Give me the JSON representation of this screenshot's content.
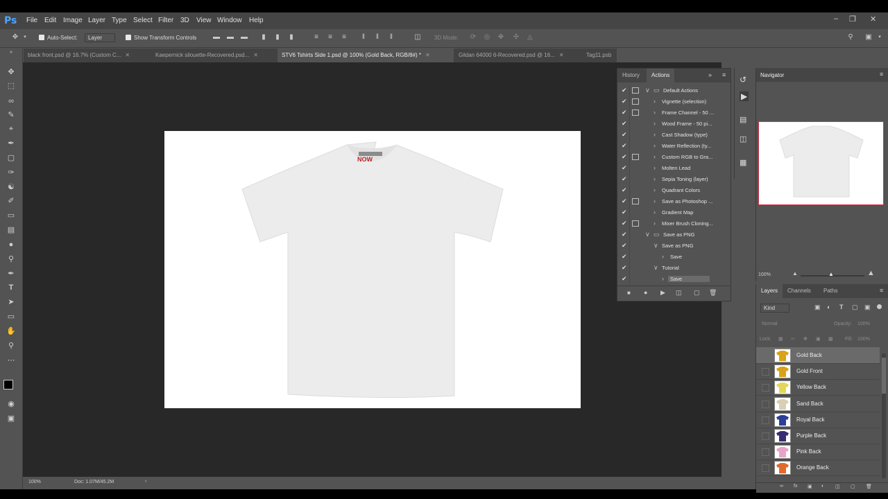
{
  "app": {
    "logo": "Ps",
    "menu": [
      "File",
      "Edit",
      "Image",
      "Layer",
      "Type",
      "Select",
      "Filter",
      "3D",
      "View",
      "Window",
      "Help"
    ]
  },
  "options": {
    "auto_select_label": "Auto-Select:",
    "auto_select_value": "Layer",
    "transform_label": "Show Transform Controls",
    "mode_3d": "3D Mode:"
  },
  "tabs": [
    {
      "label": "black front.psd @ 16.7% (Custom C...",
      "active": false
    },
    {
      "label": "Kaepernick silouette-Recovered.psd...",
      "active": false
    },
    {
      "label": "STV6 Tshirts Side 1.psd @ 100% (Gold Back, RGB/8#) *",
      "active": true
    },
    {
      "label": "Gildan 64000 6-Recovered.psd @ 16...",
      "active": false
    },
    {
      "label": "Tag11.psb",
      "active": false
    }
  ],
  "status": {
    "zoom": "100%",
    "doc": "Doc: 1.07M/45.2M"
  },
  "actions_panel": {
    "tab_history": "History",
    "tab_actions": "Actions",
    "rows": [
      {
        "label": "Default Actions",
        "indent": 0,
        "folder": true,
        "dialog": true,
        "open": true
      },
      {
        "label": "Vignette (selection)",
        "indent": 1,
        "dialog": true
      },
      {
        "label": "Frame Channel - 50 ...",
        "indent": 1,
        "dialog": true
      },
      {
        "label": "Wood Frame - 50 pi...",
        "indent": 1,
        "dialog": false
      },
      {
        "label": "Cast Shadow (type)",
        "indent": 1,
        "dialog": false
      },
      {
        "label": "Water Reflection (ty...",
        "indent": 1,
        "dialog": false
      },
      {
        "label": "Custom RGB to Gra...",
        "indent": 1,
        "dialog": true
      },
      {
        "label": "Molten Lead",
        "indent": 1,
        "dialog": false
      },
      {
        "label": "Sepia Toning (layer)",
        "indent": 1,
        "dialog": false
      },
      {
        "label": "Quadrant Colors",
        "indent": 1,
        "dialog": false
      },
      {
        "label": "Save as Photoshop ...",
        "indent": 1,
        "dialog": true
      },
      {
        "label": "Gradient Map",
        "indent": 1,
        "dialog": false
      },
      {
        "label": "Mixer Brush Cloning...",
        "indent": 1,
        "dialog": true
      },
      {
        "label": "Save as PNG",
        "indent": 0,
        "folder": true,
        "dialog": false,
        "open": true
      },
      {
        "label": "Save as PNG",
        "indent": 1,
        "dialog": false,
        "open": true
      },
      {
        "label": "Save",
        "indent": 2,
        "dialog": false
      },
      {
        "label": "Tutorial",
        "indent": 1,
        "dialog": false,
        "open": true
      },
      {
        "label": "Save",
        "indent": 2,
        "dialog": false,
        "selected": true
      }
    ]
  },
  "navigator": {
    "title": "Navigator",
    "zoom": "100%"
  },
  "layers_panel": {
    "tab_layers": "Layers",
    "tab_channels": "Channels",
    "tab_paths": "Paths",
    "kind": "Kind",
    "blend": "Normal",
    "opacity_label": "Opacity:",
    "opacity": "100%",
    "lock_label": "Lock:",
    "fill_label": "Fill:",
    "fill": "100%",
    "layers": [
      {
        "name": "Gold Back",
        "color": "#d9a21b",
        "selected": true
      },
      {
        "name": "Gold Front",
        "color": "#d9a21b"
      },
      {
        "name": "Yellow Back",
        "color": "#e3d65a"
      },
      {
        "name": "Sand Back",
        "color": "#d8cfb4"
      },
      {
        "name": "Royal Back",
        "color": "#2c3e98"
      },
      {
        "name": "Purple Back",
        "color": "#3a2c72"
      },
      {
        "name": "Pink Back",
        "color": "#e7a4c7"
      },
      {
        "name": "Orange Back",
        "color": "#e06a2c"
      }
    ]
  },
  "colors": {
    "canvas_bg": "#282828",
    "panel": "#535353",
    "accent_red": "#d9314a"
  }
}
